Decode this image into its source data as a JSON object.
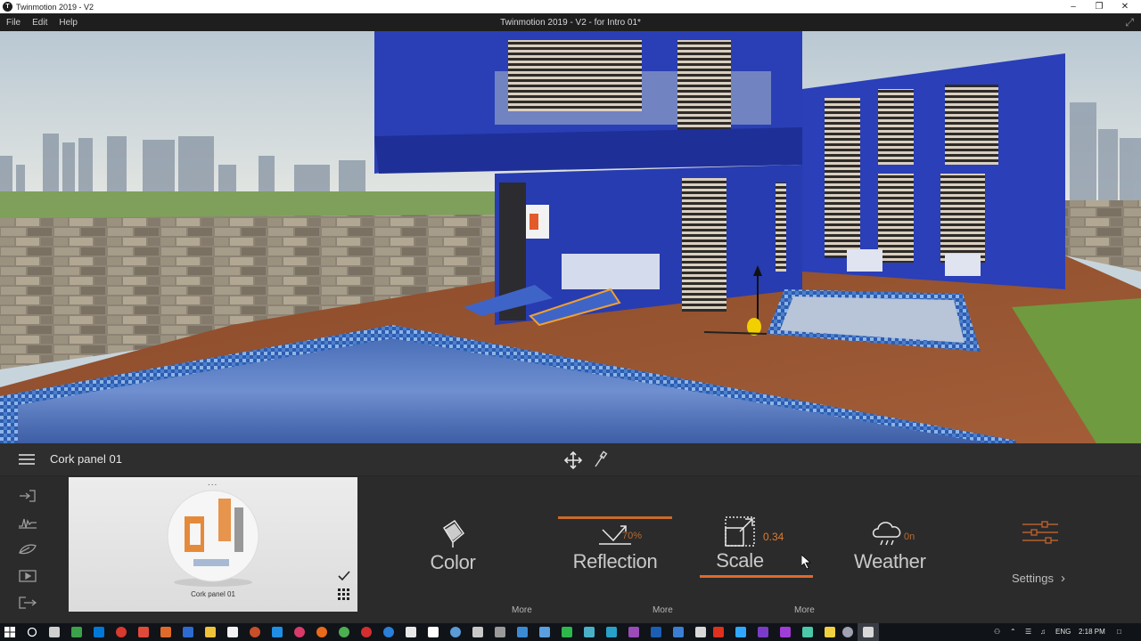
{
  "window": {
    "app_title": "Twinmotion 2019 - V2",
    "document_title": "Twinmotion 2019 - V2 - for Intro 01*"
  },
  "menu": {
    "items": [
      "File",
      "Edit",
      "Help"
    ]
  },
  "object_bar": {
    "selected_object": "Cork panel 01"
  },
  "material": {
    "name": "Cork panel 01",
    "menu_dots": "..."
  },
  "properties": {
    "color": {
      "label": "Color",
      "value": ""
    },
    "reflection": {
      "label": "Reflection",
      "value": "70%",
      "level": 0.7
    },
    "scale": {
      "label": "Scale",
      "value": "0.34"
    },
    "weather": {
      "label": "Weather",
      "value": "0n"
    }
  },
  "more_labels": [
    "More",
    "More",
    "More"
  ],
  "settings": {
    "label": "Settings"
  },
  "taskbar": {
    "language": "ENG",
    "time": "2:18 PM"
  },
  "colors": {
    "accent": "#e07a2e",
    "panel_bg": "#2b2b2b",
    "toolbar_bg": "#2e2e2e"
  },
  "icons": {
    "left_tools": [
      "import-icon",
      "waveform-icon",
      "leaf-icon",
      "media-icon",
      "export-icon"
    ]
  }
}
